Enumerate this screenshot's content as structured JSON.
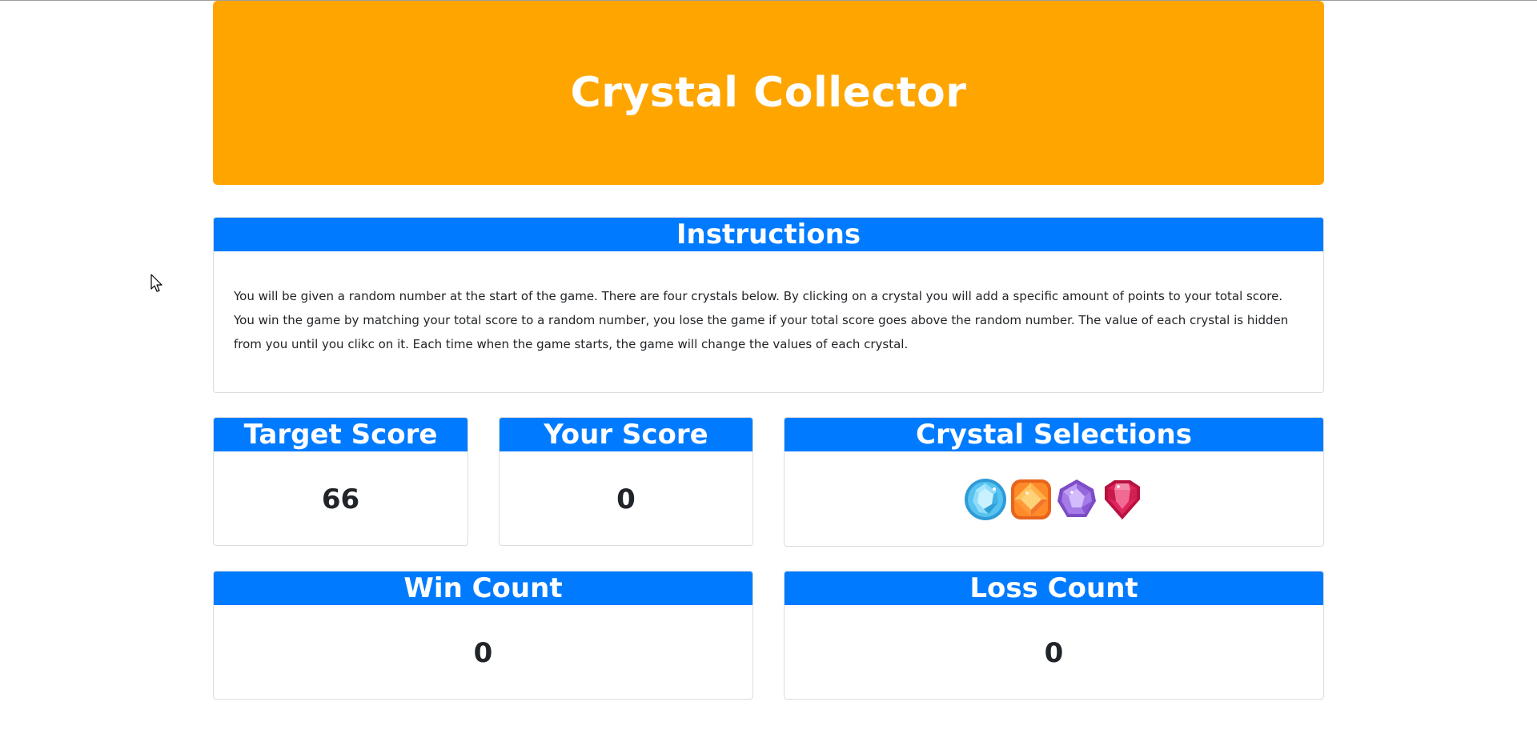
{
  "header": {
    "title": "Crystal Collector"
  },
  "instructions": {
    "title": "Instructions",
    "text": "You will be given a random number at the start of the game. There are four crystals below. By clicking on a crystal you will add a specific amount of points to your total score. You win the game by matching your total score to a random number, you lose the game if your total score goes above the random number. The value of each crystal is hidden from you until you clikc on it. Each time when the game starts, the game will change the values of each crystal."
  },
  "target_score": {
    "title": "Target Score",
    "value": "66"
  },
  "your_score": {
    "title": "Your Score",
    "value": "0"
  },
  "crystal_selections": {
    "title": "Crystal Selections",
    "crystals": [
      {
        "icon": "blue-diamond-crystal-icon",
        "color": "#4fc3f7"
      },
      {
        "icon": "orange-square-crystal-icon",
        "color": "#ff7a1a"
      },
      {
        "icon": "purple-crystal-icon",
        "color": "#9c6ade"
      },
      {
        "icon": "red-heart-crystal-icon",
        "color": "#e0245e"
      }
    ]
  },
  "win_count": {
    "title": "Win Count",
    "value": "0"
  },
  "loss_count": {
    "title": "Loss Count",
    "value": "0"
  },
  "colors": {
    "jumbotron": "#ffa500",
    "header_blue": "#007bff"
  }
}
